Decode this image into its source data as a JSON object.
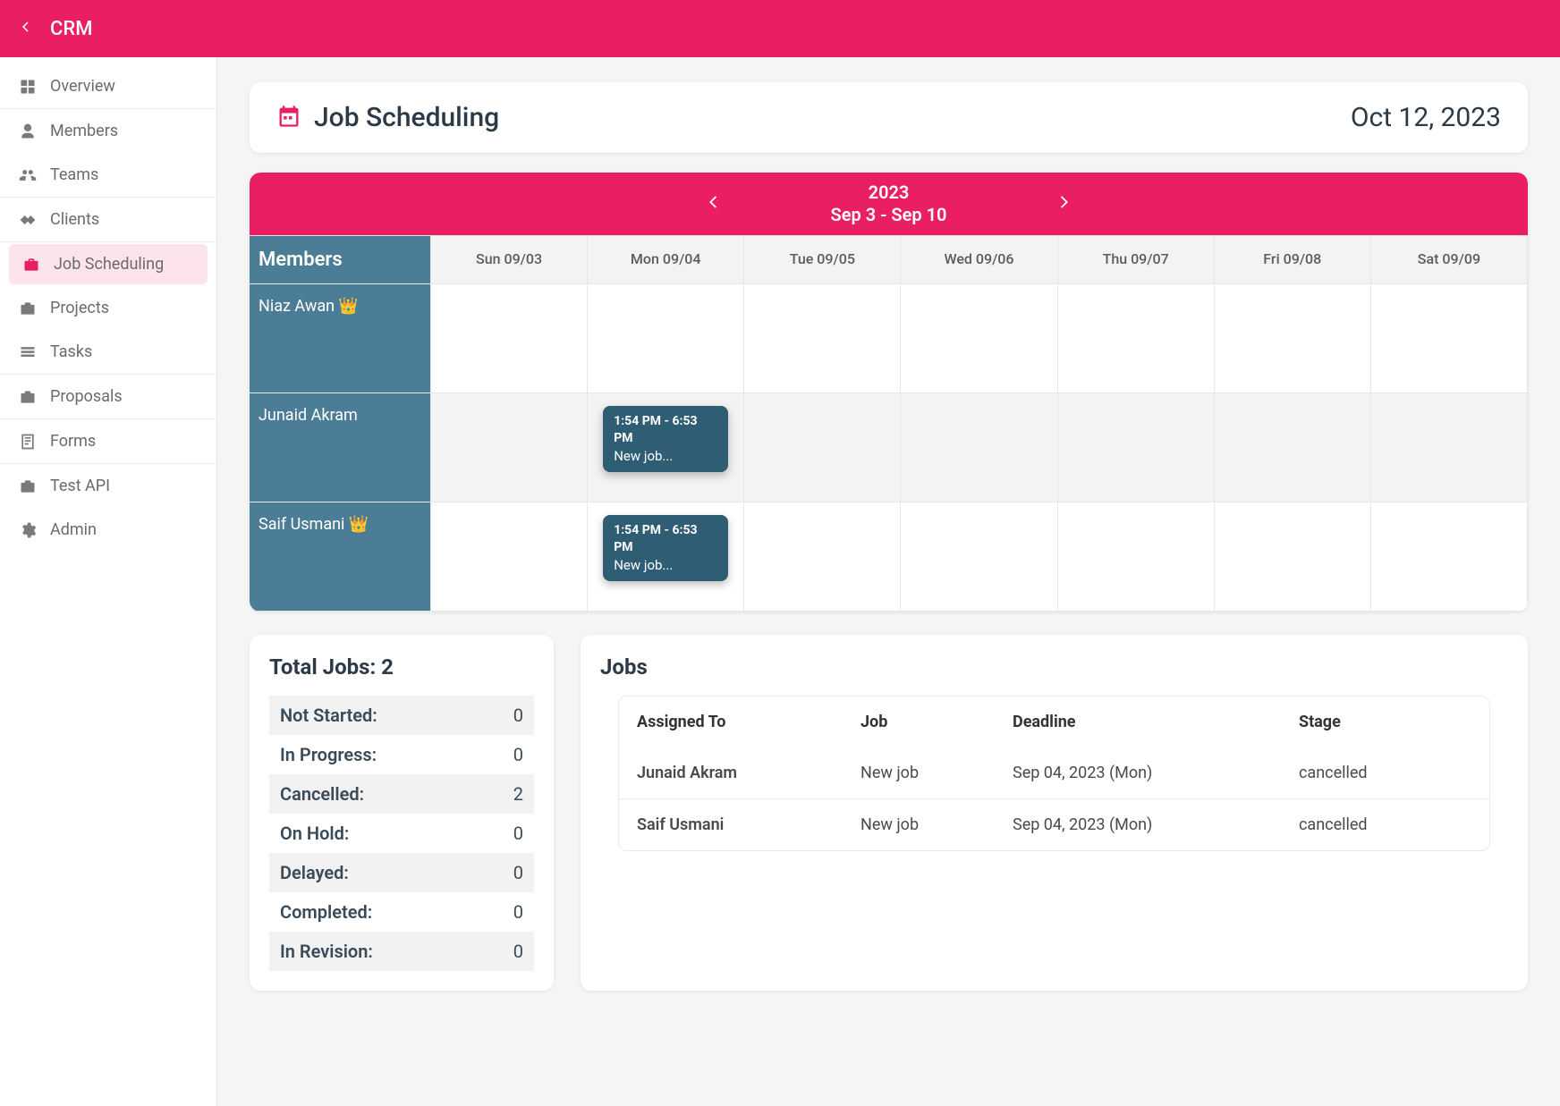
{
  "app": {
    "title": "CRM"
  },
  "header": {
    "title": "Job Scheduling",
    "date": "Oct 12, 2023"
  },
  "sidebar": {
    "items": [
      {
        "label": "Overview"
      },
      {
        "label": "Members"
      },
      {
        "label": "Teams"
      },
      {
        "label": "Clients"
      },
      {
        "label": "Job Scheduling"
      },
      {
        "label": "Projects"
      },
      {
        "label": "Tasks"
      },
      {
        "label": "Proposals"
      },
      {
        "label": "Forms"
      },
      {
        "label": "Test API"
      },
      {
        "label": "Admin"
      }
    ]
  },
  "weekNav": {
    "year": "2023",
    "range": "Sep 3 - Sep 10"
  },
  "columns": {
    "membersHeader": "Members",
    "days": [
      "Sun 09/03",
      "Mon 09/04",
      "Tue 09/05",
      "Wed 09/06",
      "Thu 09/07",
      "Fri 09/08",
      "Sat 09/09"
    ]
  },
  "members": [
    {
      "name": "Niaz Awan",
      "crown": "👑",
      "jobs": [
        null,
        null,
        null,
        null,
        null,
        null,
        null
      ]
    },
    {
      "name": "Junaid Akram",
      "crown": "",
      "jobs": [
        null,
        {
          "time": "1:54 PM - 6:53 PM",
          "title": "New job..."
        },
        null,
        null,
        null,
        null,
        null
      ]
    },
    {
      "name": "Saif Usmani",
      "crown": "👑",
      "jobs": [
        null,
        {
          "time": "1:54 PM - 6:53 PM",
          "title": "New job..."
        },
        null,
        null,
        null,
        null,
        null
      ]
    }
  ],
  "stats": {
    "title": "Total Jobs: 2",
    "rows": [
      {
        "label": "Not Started:",
        "value": "0"
      },
      {
        "label": "In Progress:",
        "value": "0"
      },
      {
        "label": "Cancelled:",
        "value": "2"
      },
      {
        "label": "On Hold:",
        "value": "0"
      },
      {
        "label": "Delayed:",
        "value": "0"
      },
      {
        "label": "Completed:",
        "value": "0"
      },
      {
        "label": "In Revision:",
        "value": "0"
      }
    ]
  },
  "jobsTable": {
    "title": "Jobs",
    "headers": {
      "assigned": "Assigned To",
      "job": "Job",
      "deadline": "Deadline",
      "stage": "Stage"
    },
    "rows": [
      {
        "assigned": "Junaid Akram",
        "job": "New job",
        "deadline": "Sep 04, 2023 (Mon)",
        "stage": "cancelled"
      },
      {
        "assigned": "Saif Usmani",
        "job": "New job",
        "deadline": "Sep 04, 2023 (Mon)",
        "stage": "cancelled"
      }
    ]
  }
}
